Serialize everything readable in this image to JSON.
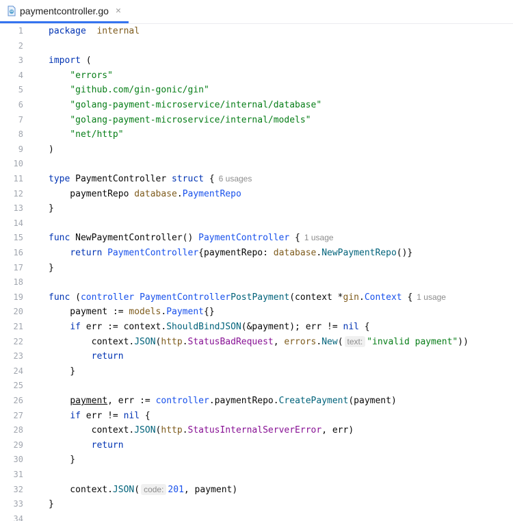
{
  "tab": {
    "title": "paymentcontroller.go",
    "close": "×",
    "icon": "go-file-icon"
  },
  "lines": [
    {
      "n": "1",
      "t": [
        [
          "kw",
          "package"
        ],
        [
          "",
          "  "
        ],
        [
          "pkg",
          "internal"
        ]
      ]
    },
    {
      "n": "2",
      "t": []
    },
    {
      "n": "3",
      "t": [
        [
          "kw",
          "import"
        ],
        [
          "",
          " ("
        ]
      ]
    },
    {
      "n": "4",
      "t": [
        [
          "",
          "    "
        ],
        [
          "str",
          "\"errors\""
        ]
      ]
    },
    {
      "n": "5",
      "t": [
        [
          "",
          "    "
        ],
        [
          "str",
          "\"github.com/gin-gonic/gin\""
        ]
      ]
    },
    {
      "n": "6",
      "t": [
        [
          "",
          "    "
        ],
        [
          "str",
          "\"golang-payment-microservice/internal/database\""
        ]
      ]
    },
    {
      "n": "7",
      "t": [
        [
          "",
          "    "
        ],
        [
          "str",
          "\"golang-payment-microservice/internal/models\""
        ]
      ]
    },
    {
      "n": "8",
      "t": [
        [
          "",
          "    "
        ],
        [
          "str",
          "\"net/http\""
        ]
      ]
    },
    {
      "n": "9",
      "t": [
        [
          "",
          ")"
        ]
      ]
    },
    {
      "n": "10",
      "t": []
    },
    {
      "n": "11",
      "t": [
        [
          "kw",
          "type"
        ],
        [
          "",
          " PaymentController "
        ],
        [
          "kw",
          "struct"
        ],
        [
          "",
          " {"
        ],
        [
          "hint",
          "6 usages"
        ]
      ]
    },
    {
      "n": "12",
      "t": [
        [
          "",
          "    paymentRepo "
        ],
        [
          "pkg",
          "database"
        ],
        [
          "",
          "."
        ],
        [
          "ty",
          "PaymentRepo"
        ]
      ]
    },
    {
      "n": "13",
      "t": [
        [
          "",
          "}"
        ]
      ]
    },
    {
      "n": "14",
      "t": []
    },
    {
      "n": "15",
      "t": [
        [
          "kw",
          "func"
        ],
        [
          "",
          " NewPaymentController() "
        ],
        [
          "ty",
          "PaymentController"
        ],
        [
          "",
          " {"
        ],
        [
          "hint",
          "1 usage"
        ]
      ]
    },
    {
      "n": "16",
      "t": [
        [
          "",
          "    "
        ],
        [
          "kw",
          "return"
        ],
        [
          "",
          " "
        ],
        [
          "ty",
          "PaymentController"
        ],
        [
          "",
          "{paymentRepo: "
        ],
        [
          "pkg",
          "database"
        ],
        [
          "",
          "."
        ],
        [
          "meth",
          "NewPaymentRepo"
        ],
        [
          "",
          "()}"
        ]
      ]
    },
    {
      "n": "17",
      "t": [
        [
          "",
          "}"
        ]
      ]
    },
    {
      "n": "18",
      "t": []
    },
    {
      "n": "19",
      "t": [
        [
          "kw",
          "func"
        ],
        [
          "",
          " ("
        ],
        [
          "ctrl",
          "controller"
        ],
        [
          "",
          " "
        ],
        [
          "ty",
          "PaymentController"
        ],
        [
          ") "
        ],
        [
          "fn",
          "PostPayment"
        ],
        [
          "",
          "(context *"
        ],
        [
          "pkg",
          "gin"
        ],
        [
          "",
          "."
        ],
        [
          "ty",
          "Context"
        ],
        [
          "",
          " {"
        ],
        [
          "hint",
          "1 usage"
        ]
      ]
    },
    {
      "n": "20",
      "t": [
        [
          "",
          "    payment := "
        ],
        [
          "pkg",
          "models"
        ],
        [
          "",
          "."
        ],
        [
          "ty",
          "Payment"
        ],
        [
          "",
          "{}"
        ]
      ]
    },
    {
      "n": "21",
      "t": [
        [
          "",
          "    "
        ],
        [
          "kw",
          "if"
        ],
        [
          "",
          " err := context."
        ],
        [
          "meth",
          "ShouldBindJSON"
        ],
        [
          "",
          "(&payment); err != "
        ],
        [
          "kw",
          "nil"
        ],
        [
          "",
          " {"
        ]
      ]
    },
    {
      "n": "22",
      "t": [
        [
          "",
          "        context."
        ],
        [
          "meth",
          "JSON"
        ],
        [
          "",
          "("
        ],
        [
          "pkg",
          "http"
        ],
        [
          "",
          "."
        ],
        [
          "field",
          "StatusBadRequest"
        ],
        [
          "",
          ", "
        ],
        [
          "pkg",
          "errors"
        ],
        [
          "",
          "."
        ],
        [
          "meth",
          "New"
        ],
        [
          "",
          "("
        ],
        [
          "inlay",
          "text:"
        ],
        [
          "str",
          "\"invalid payment\""
        ],
        [
          "",
          "))"
        ]
      ]
    },
    {
      "n": "23",
      "t": [
        [
          "",
          "        "
        ],
        [
          "kw",
          "return"
        ]
      ]
    },
    {
      "n": "24",
      "t": [
        [
          "",
          "    }"
        ]
      ]
    },
    {
      "n": "25",
      "t": []
    },
    {
      "n": "26",
      "t": [
        [
          "",
          "    "
        ],
        [
          "ul",
          "payment"
        ],
        [
          "",
          ", err := "
        ],
        [
          "ctrl",
          "controller"
        ],
        [
          "",
          ".paymentRepo."
        ],
        [
          "meth",
          "CreatePayment"
        ],
        [
          "",
          "(payment)"
        ]
      ]
    },
    {
      "n": "27",
      "t": [
        [
          "",
          "    "
        ],
        [
          "kw",
          "if"
        ],
        [
          "",
          " err != "
        ],
        [
          "kw",
          "nil"
        ],
        [
          "",
          " {"
        ]
      ]
    },
    {
      "n": "28",
      "t": [
        [
          "",
          "        context."
        ],
        [
          "meth",
          "JSON"
        ],
        [
          "",
          "("
        ],
        [
          "pkg",
          "http"
        ],
        [
          "",
          "."
        ],
        [
          "field",
          "StatusInternalServerError"
        ],
        [
          "",
          ", err)"
        ]
      ]
    },
    {
      "n": "29",
      "t": [
        [
          "",
          "        "
        ],
        [
          "kw",
          "return"
        ]
      ]
    },
    {
      "n": "30",
      "t": [
        [
          "",
          "    }"
        ]
      ]
    },
    {
      "n": "31",
      "t": []
    },
    {
      "n": "32",
      "t": [
        [
          "",
          "    context."
        ],
        [
          "meth",
          "JSON"
        ],
        [
          "",
          "("
        ],
        [
          "inlay",
          "code:"
        ],
        [
          "num",
          "201"
        ],
        [
          "",
          ", payment)"
        ]
      ]
    },
    {
      "n": "33",
      "t": [
        [
          "",
          "}"
        ]
      ]
    },
    {
      "n": "34",
      "t": []
    }
  ]
}
